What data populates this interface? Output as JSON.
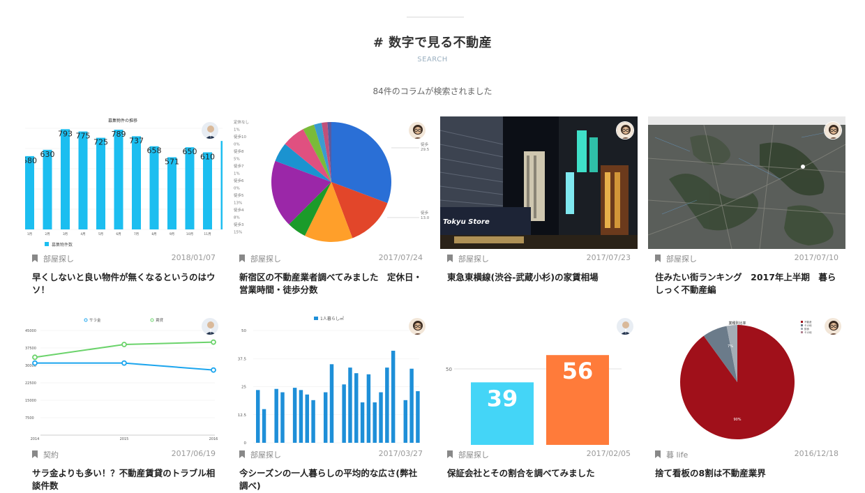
{
  "header": {
    "title": "# 数字で見る不動産",
    "subtitle": "SEARCH",
    "result_count": "84件のコラムが検索されました"
  },
  "colors": {
    "chart_blue": "#1cbef0",
    "green": "#6bd36b",
    "red": "#a0101a",
    "orange": "#ff7b3a",
    "cyan": "#44d5f7"
  },
  "cards": [
    {
      "category": "部屋探し",
      "date": "2018/01/07",
      "title": "早くしないと良い物件が無くなるというのはウソ！",
      "thumbnail": {
        "type": "bar",
        "title": "募集物件の推移",
        "labels": [
          "580",
          "630",
          "793",
          "775",
          "725",
          "789",
          "737",
          "658",
          "571",
          "650",
          "610",
          "6"
        ],
        "x_labels": [
          "1月",
          "2月",
          "3月",
          "4月",
          "5月",
          "6月",
          "7月",
          "8月",
          "9月",
          "10月",
          "11月",
          "1"
        ],
        "legend": "募集物件数"
      }
    },
    {
      "category": "部屋探し",
      "date": "2017/07/24",
      "title": "新宿区の不動産業者調べてみました　定休日・営業時間・徒歩分数",
      "thumbnail": {
        "type": "pie",
        "slices": [
          29.5,
          13.0,
          12.5,
          5,
          17.5,
          5,
          6,
          3,
          2,
          1.5,
          1
        ],
        "slice_colors": [
          "#2a6fd6",
          "#e2462a",
          "#ff9f2a",
          "#1b9b2a",
          "#9b27a8",
          "#1b93d0",
          "#e05080",
          "#7abb3a",
          "#3a9bd0",
          "#c0507a",
          "#5a5aa0"
        ],
        "left_labels": [
          "定休なし",
          "1%",
          "徒歩10",
          "0%",
          "徒歩8",
          "5%",
          "徒歩7",
          "1%",
          "徒歩6",
          "0%",
          "徒歩5",
          "13%",
          "徒歩4",
          "8%",
          "徒歩3",
          "15%"
        ],
        "right_labels": [
          "徒歩",
          "29.5",
          "徒歩",
          "13.0"
        ]
      }
    },
    {
      "category": "部屋探し",
      "date": "2017/07/23",
      "title": "東急東横線(渋谷-武蔵小杉)の家賃相場",
      "thumbnail": {
        "type": "photo",
        "sign_text": "Tokyu Store"
      }
    },
    {
      "category": "部屋探し",
      "date": "2017/07/10",
      "title": "住みたい街ランキング　2017年上半期　暮らしっく不動産編",
      "thumbnail": {
        "type": "map"
      }
    },
    {
      "category": "契約",
      "date": "2017/06/19",
      "title": "サラ金よりも多い！？不動産賃貸のトラブル相談件数",
      "thumbnail": {
        "type": "line",
        "legend": [
          "サラ金",
          "賃貸"
        ],
        "y_ticks": [
          "45000",
          "37500",
          "30000",
          "22500",
          "15000",
          "7500"
        ],
        "x_ticks": [
          "2014",
          "2015",
          "2016"
        ],
        "series": [
          {
            "name": "サラ金",
            "values": [
              31000,
              31000,
              28000
            ]
          },
          {
            "name": "賃貸",
            "values": [
              33500,
              39000,
              40000
            ]
          }
        ],
        "ylim": [
          0,
          45000
        ]
      }
    },
    {
      "category": "部屋探し",
      "date": "2017/03/27",
      "title": "今シーズンの一人暮らしの平均的な広さ(弊社調べ)",
      "thumbnail": {
        "type": "bar",
        "legend": "1人暮らし㎡",
        "y_ticks": [
          "50",
          "37.5",
          "25",
          "12.5",
          "0"
        ],
        "values": [
          23.5,
          15,
          0,
          24,
          22.5,
          0,
          24.5,
          23.5,
          21.5,
          19,
          0,
          22.5,
          35,
          0,
          26,
          33.5,
          31,
          18,
          30.5,
          18,
          22.5,
          33.5,
          41,
          0,
          19,
          33,
          23
        ],
        "ylim": [
          0,
          50
        ]
      }
    },
    {
      "category": "部屋探し",
      "date": "2017/02/05",
      "title": "保証会社とその割合を調べてみました",
      "thumbnail": {
        "type": "bar",
        "y_tick": "50",
        "values": [
          39,
          56
        ],
        "labels": [
          "39",
          "56"
        ]
      }
    },
    {
      "category": "暮 life",
      "date": "2016/12/18",
      "title": "捨て看板の8割は不動産業界",
      "thumbnail": {
        "type": "pie",
        "title": "業種別比率",
        "slices": [
          90,
          7,
          3
        ],
        "slice_labels": [
          "90%",
          "7%",
          ""
        ],
        "legend": [
          "不動産",
          "その他",
          "飲食",
          "その他"
        ]
      }
    }
  ]
}
